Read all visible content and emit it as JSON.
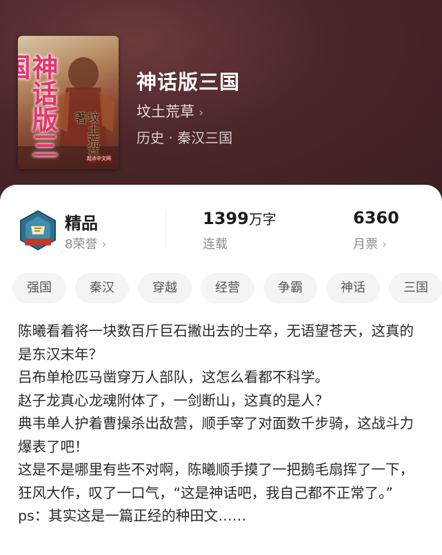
{
  "book": {
    "title": "神话版三国",
    "author": "坟土荒草",
    "author_chevron": "›",
    "genre": "历史 · 秦汉三国",
    "cover": {
      "title": "神话版三国",
      "author_line": "坟土荒草·著",
      "publisher": "起点中文网"
    }
  },
  "stats": {
    "badge": {
      "label": "精品",
      "sub": "8荣誉",
      "icon": "quality-badge-icon"
    },
    "words": {
      "value": "1399",
      "unit": "万字",
      "sub": "连载"
    },
    "tickets": {
      "value": "6360",
      "sub": "月票"
    }
  },
  "tags": [
    "强国",
    "秦汉",
    "穿越",
    "经营",
    "争霸",
    "神话",
    "三国"
  ],
  "description": [
    "陈曦看着将一块数百斤巨石撇出去的士卒，无语望苍天，这真的是东汉末年？",
    "吕布单枪匹马凿穿万人部队，这怎么看都不科学。",
    "赵子龙真心龙魂附体了，一剑断山，这真的是人？",
    "典韦单人护着曹操杀出敌营，顺手宰了对面数千步骑，这战斗力爆表了吧！",
    "这是不是哪里有些不对啊，陈曦顺手摸了一把鹅毛扇挥了一下，狂风大作，叹了一口气，“这是神话吧，我自己都不正常了。”",
    "ps：其实这是一篇正经的种田文……"
  ],
  "colors": {
    "header_bg": "#4a2629",
    "cover_title": "#e4356f"
  }
}
